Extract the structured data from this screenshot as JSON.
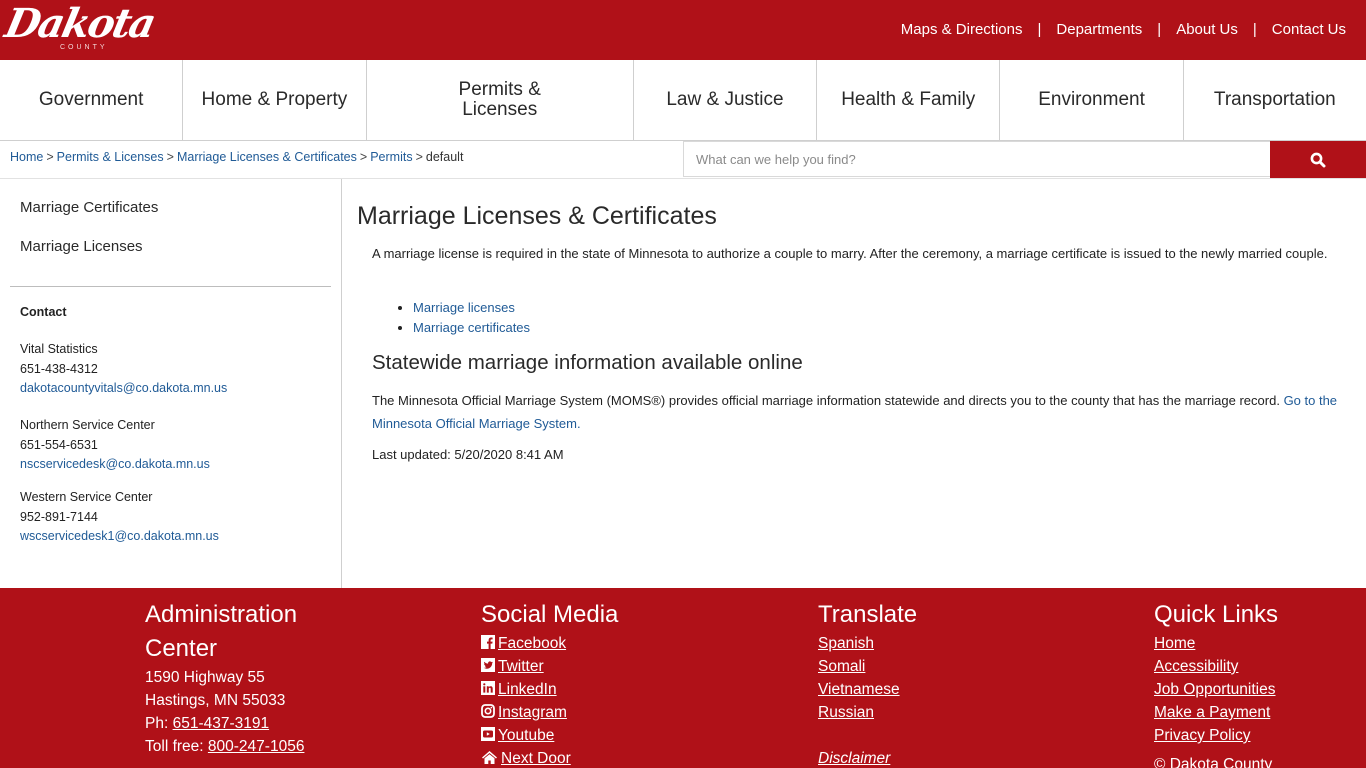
{
  "brand": {
    "logo_text": "Dakota",
    "logo_subtext": "COUNTY",
    "color_primary": "#b01118",
    "color_link": "#1f5a96"
  },
  "toplinks": [
    {
      "label": "Maps & Directions"
    },
    {
      "label": "Departments"
    },
    {
      "label": "About Us"
    },
    {
      "label": "Contact Us"
    }
  ],
  "toplinks_separator": "|",
  "mainnav": [
    {
      "label": "Government"
    },
    {
      "label": "Home & Property"
    },
    {
      "label": "Permits & Licenses"
    },
    {
      "label": "Law & Justice"
    },
    {
      "label": "Health & Family"
    },
    {
      "label": "Environment"
    },
    {
      "label": "Transportation"
    }
  ],
  "breadcrumb": {
    "items": [
      {
        "label": "Home"
      },
      {
        "label": "Permits & Licenses"
      },
      {
        "label": "Marriage Licenses & Certificates"
      },
      {
        "label": "Permits"
      }
    ],
    "current": "default",
    "separator": ">"
  },
  "search": {
    "placeholder": "What can we help you find?",
    "value": "",
    "button_icon": "search-icon"
  },
  "sidebar": {
    "nav": [
      {
        "label": "Marriage Certificates"
      },
      {
        "label": "Marriage Licenses"
      }
    ],
    "contact_title": "Contact",
    "contacts": [
      {
        "name": "Vital Statistics",
        "phone": "651-438-4312",
        "email": "dakotacountyvitals@co.dakota.mn.us"
      },
      {
        "name": "Northern Service Center",
        "phone": "651-554-6531",
        "email": "nscservicedesk@co.dakota.mn.us"
      },
      {
        "name": "Western Service Center",
        "phone": "952-891-7144",
        "email": "wscservicedesk1@co.dakota.mn.us"
      }
    ]
  },
  "content": {
    "title": "Marriage Licenses & Certificates",
    "intro": "A marriage license is required in the state of Minnesota to authorize a couple to marry. After the ceremony, a marriage certificate is issued to the newly married couple.",
    "links": [
      {
        "label": "Marriage licenses"
      },
      {
        "label": "Marriage certificates"
      }
    ],
    "subheading": "Statewide marriage information available online",
    "moms_text": "The Minnesota Official Marriage System (MOMS®) provides official marriage information statewide and directs you to the county that has the marriage record.",
    "moms_link": "Go to the Minnesota Official Marriage System.",
    "last_updated": "Last updated: 5/20/2020 8:41 AM"
  },
  "footer": {
    "admin": {
      "title": "Administration Center",
      "address1": "1590 Highway 55",
      "address2": "Hastings, MN 55033",
      "phone_label": "Ph:",
      "phone": "651-437-3191",
      "tollfree_label": "Toll free:",
      "tollfree": "800-247-1056"
    },
    "social": {
      "title": "Social Media",
      "items": [
        {
          "label": "Facebook",
          "icon": "facebook-icon"
        },
        {
          "label": "Twitter",
          "icon": "twitter-icon"
        },
        {
          "label": "LinkedIn",
          "icon": "linkedin-icon"
        },
        {
          "label": "Instagram",
          "icon": "instagram-icon"
        },
        {
          "label": "Youtube",
          "icon": "youtube-icon"
        },
        {
          "label": "Next Door",
          "icon": "home-icon"
        }
      ]
    },
    "translate": {
      "title": "Translate",
      "items": [
        {
          "label": "Spanish"
        },
        {
          "label": "Somali"
        },
        {
          "label": "Vietnamese"
        },
        {
          "label": "Russian"
        }
      ],
      "disclaimer": "Disclaimer"
    },
    "quicklinks": {
      "title": "Quick Links",
      "items": [
        {
          "label": "Home"
        },
        {
          "label": "Accessibility"
        },
        {
          "label": "Job Opportunities"
        },
        {
          "label": "Make a Payment"
        },
        {
          "label": "Privacy Policy"
        }
      ],
      "copyright": "© Dakota County"
    }
  }
}
